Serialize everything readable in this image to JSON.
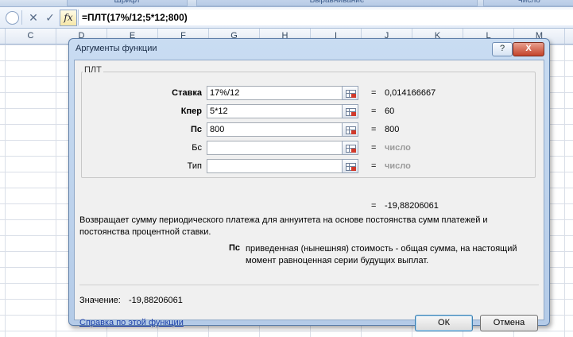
{
  "ribbon": {
    "groups": [
      "Шрифт",
      "Выравнивание",
      "Число"
    ]
  },
  "formula_bar": {
    "cancel_symbol": "✕",
    "enter_symbol": "✓",
    "fx_label": "fx",
    "formula": "=ПЛТ(17%/12;5*12;800)"
  },
  "sheet": {
    "columns": [
      "C",
      "D",
      "E",
      "F",
      "G",
      "H",
      "I",
      "J",
      "K",
      "L",
      "M"
    ]
  },
  "dialog": {
    "title": "Аргументы функции",
    "help_button": "?",
    "close_button": "X",
    "function_name": "ПЛТ",
    "arguments": [
      {
        "label": "Ставка",
        "value": "17%/12",
        "result": "0,014166667",
        "bold": true
      },
      {
        "label": "Кпер",
        "value": "5*12",
        "result": "60",
        "bold": true
      },
      {
        "label": "Пс",
        "value": "800",
        "result": "800",
        "bold": true
      },
      {
        "label": "Бс",
        "value": "",
        "result": "число",
        "bold": false
      },
      {
        "label": "Тип",
        "value": "",
        "result": "число",
        "bold": false
      }
    ],
    "equals_sign": "=",
    "total_result": "-19,88206061",
    "description": "Возвращает сумму периодического платежа для аннуитета на основе постоянства сумм платежей и постоянства процентной ставки.",
    "param_name": "Пс",
    "param_description": "приведенная (нынешняя) стоимость - общая сумма, на настоящий момент равноценная серии будущих выплат.",
    "value_label": "Значение:",
    "value": "-19,88206061",
    "help_link": "Справка по этой функции",
    "ok_button": "ОК",
    "cancel_button": "Отмена"
  }
}
